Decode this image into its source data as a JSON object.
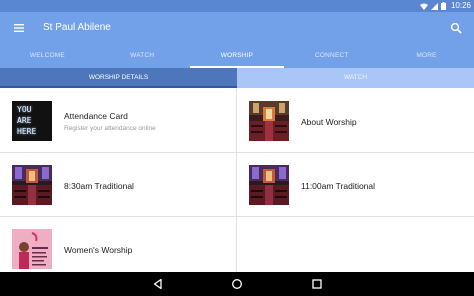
{
  "status_bar": {
    "time": "10:26",
    "icons": [
      "wifi-icon",
      "signal-icon",
      "battery-icon"
    ]
  },
  "app_bar": {
    "title": "St Paul Abilene",
    "menu_icon": "menu-icon",
    "search_icon": "search-icon",
    "background": "#72a1ea"
  },
  "tabs": [
    {
      "label": "WELCOME",
      "active": false
    },
    {
      "label": "WATCH",
      "active": false
    },
    {
      "label": "WORSHIP",
      "active": true
    },
    {
      "label": "CONNECT",
      "active": false
    },
    {
      "label": "MORE",
      "active": false
    }
  ],
  "subtabs": [
    {
      "label": "WORSHIP DETAILS",
      "active": true
    },
    {
      "label": "WATCH",
      "active": false
    }
  ],
  "cards": [
    {
      "title": "Attendance Card",
      "subtitle": "Register your attendance online",
      "thumb": "you-are-here-neon-sign"
    },
    {
      "title": "About Worship",
      "subtitle": "",
      "thumb": "church-sanctuary"
    },
    {
      "title": "8:30am Traditional",
      "subtitle": "",
      "thumb": "church-sanctuary"
    },
    {
      "title": "11:00am Traditional",
      "subtitle": "",
      "thumb": "church-sanctuary"
    },
    {
      "title": "Women's Worship",
      "subtitle": "",
      "thumb": "womens-worship-flyer"
    }
  ],
  "thumb_text": {
    "you_are_here": [
      "YOU",
      "ARE",
      "HERE"
    ]
  },
  "nav_bar": {
    "icons": [
      "back-icon",
      "home-icon",
      "recents-icon"
    ]
  }
}
